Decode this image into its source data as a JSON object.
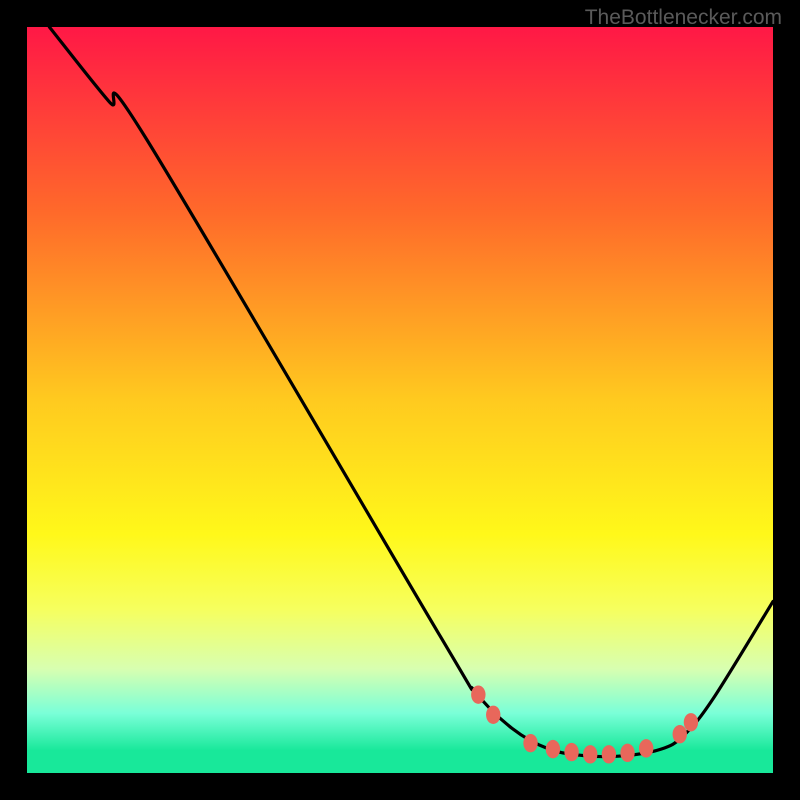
{
  "attribution": "TheBottlenecker.com",
  "chart_data": {
    "type": "line",
    "title": "",
    "xlabel": "",
    "ylabel": "",
    "xlim": [
      0,
      100
    ],
    "ylim": [
      0,
      100
    ],
    "gradient_stops": [
      {
        "offset": 0,
        "color": "#ff1846"
      },
      {
        "offset": 25,
        "color": "#ff6a2a"
      },
      {
        "offset": 50,
        "color": "#ffca1f"
      },
      {
        "offset": 68,
        "color": "#fff81a"
      },
      {
        "offset": 78,
        "color": "#f6ff5e"
      },
      {
        "offset": 86,
        "color": "#d8ffb0"
      },
      {
        "offset": 92,
        "color": "#7affd8"
      },
      {
        "offset": 97,
        "color": "#18e89a"
      },
      {
        "offset": 100,
        "color": "#18e89a"
      }
    ],
    "curve": [
      {
        "x": 3,
        "y": 100
      },
      {
        "x": 11,
        "y": 90
      },
      {
        "x": 16,
        "y": 85
      },
      {
        "x": 55,
        "y": 19
      },
      {
        "x": 60,
        "y": 11
      },
      {
        "x": 65,
        "y": 6
      },
      {
        "x": 70,
        "y": 3.2
      },
      {
        "x": 75,
        "y": 2.3
      },
      {
        "x": 80,
        "y": 2.3
      },
      {
        "x": 85,
        "y": 3.2
      },
      {
        "x": 88,
        "y": 5
      },
      {
        "x": 92,
        "y": 10
      },
      {
        "x": 100,
        "y": 23
      }
    ],
    "markers": [
      {
        "x": 60.5,
        "y": 10.5
      },
      {
        "x": 62.5,
        "y": 7.8
      },
      {
        "x": 67.5,
        "y": 4.0
      },
      {
        "x": 70.5,
        "y": 3.2
      },
      {
        "x": 73.0,
        "y": 2.8
      },
      {
        "x": 75.5,
        "y": 2.5
      },
      {
        "x": 78.0,
        "y": 2.5
      },
      {
        "x": 80.5,
        "y": 2.7
      },
      {
        "x": 83.0,
        "y": 3.3
      },
      {
        "x": 87.5,
        "y": 5.2
      },
      {
        "x": 89.0,
        "y": 6.8
      }
    ],
    "marker_color": "#e8675b"
  }
}
